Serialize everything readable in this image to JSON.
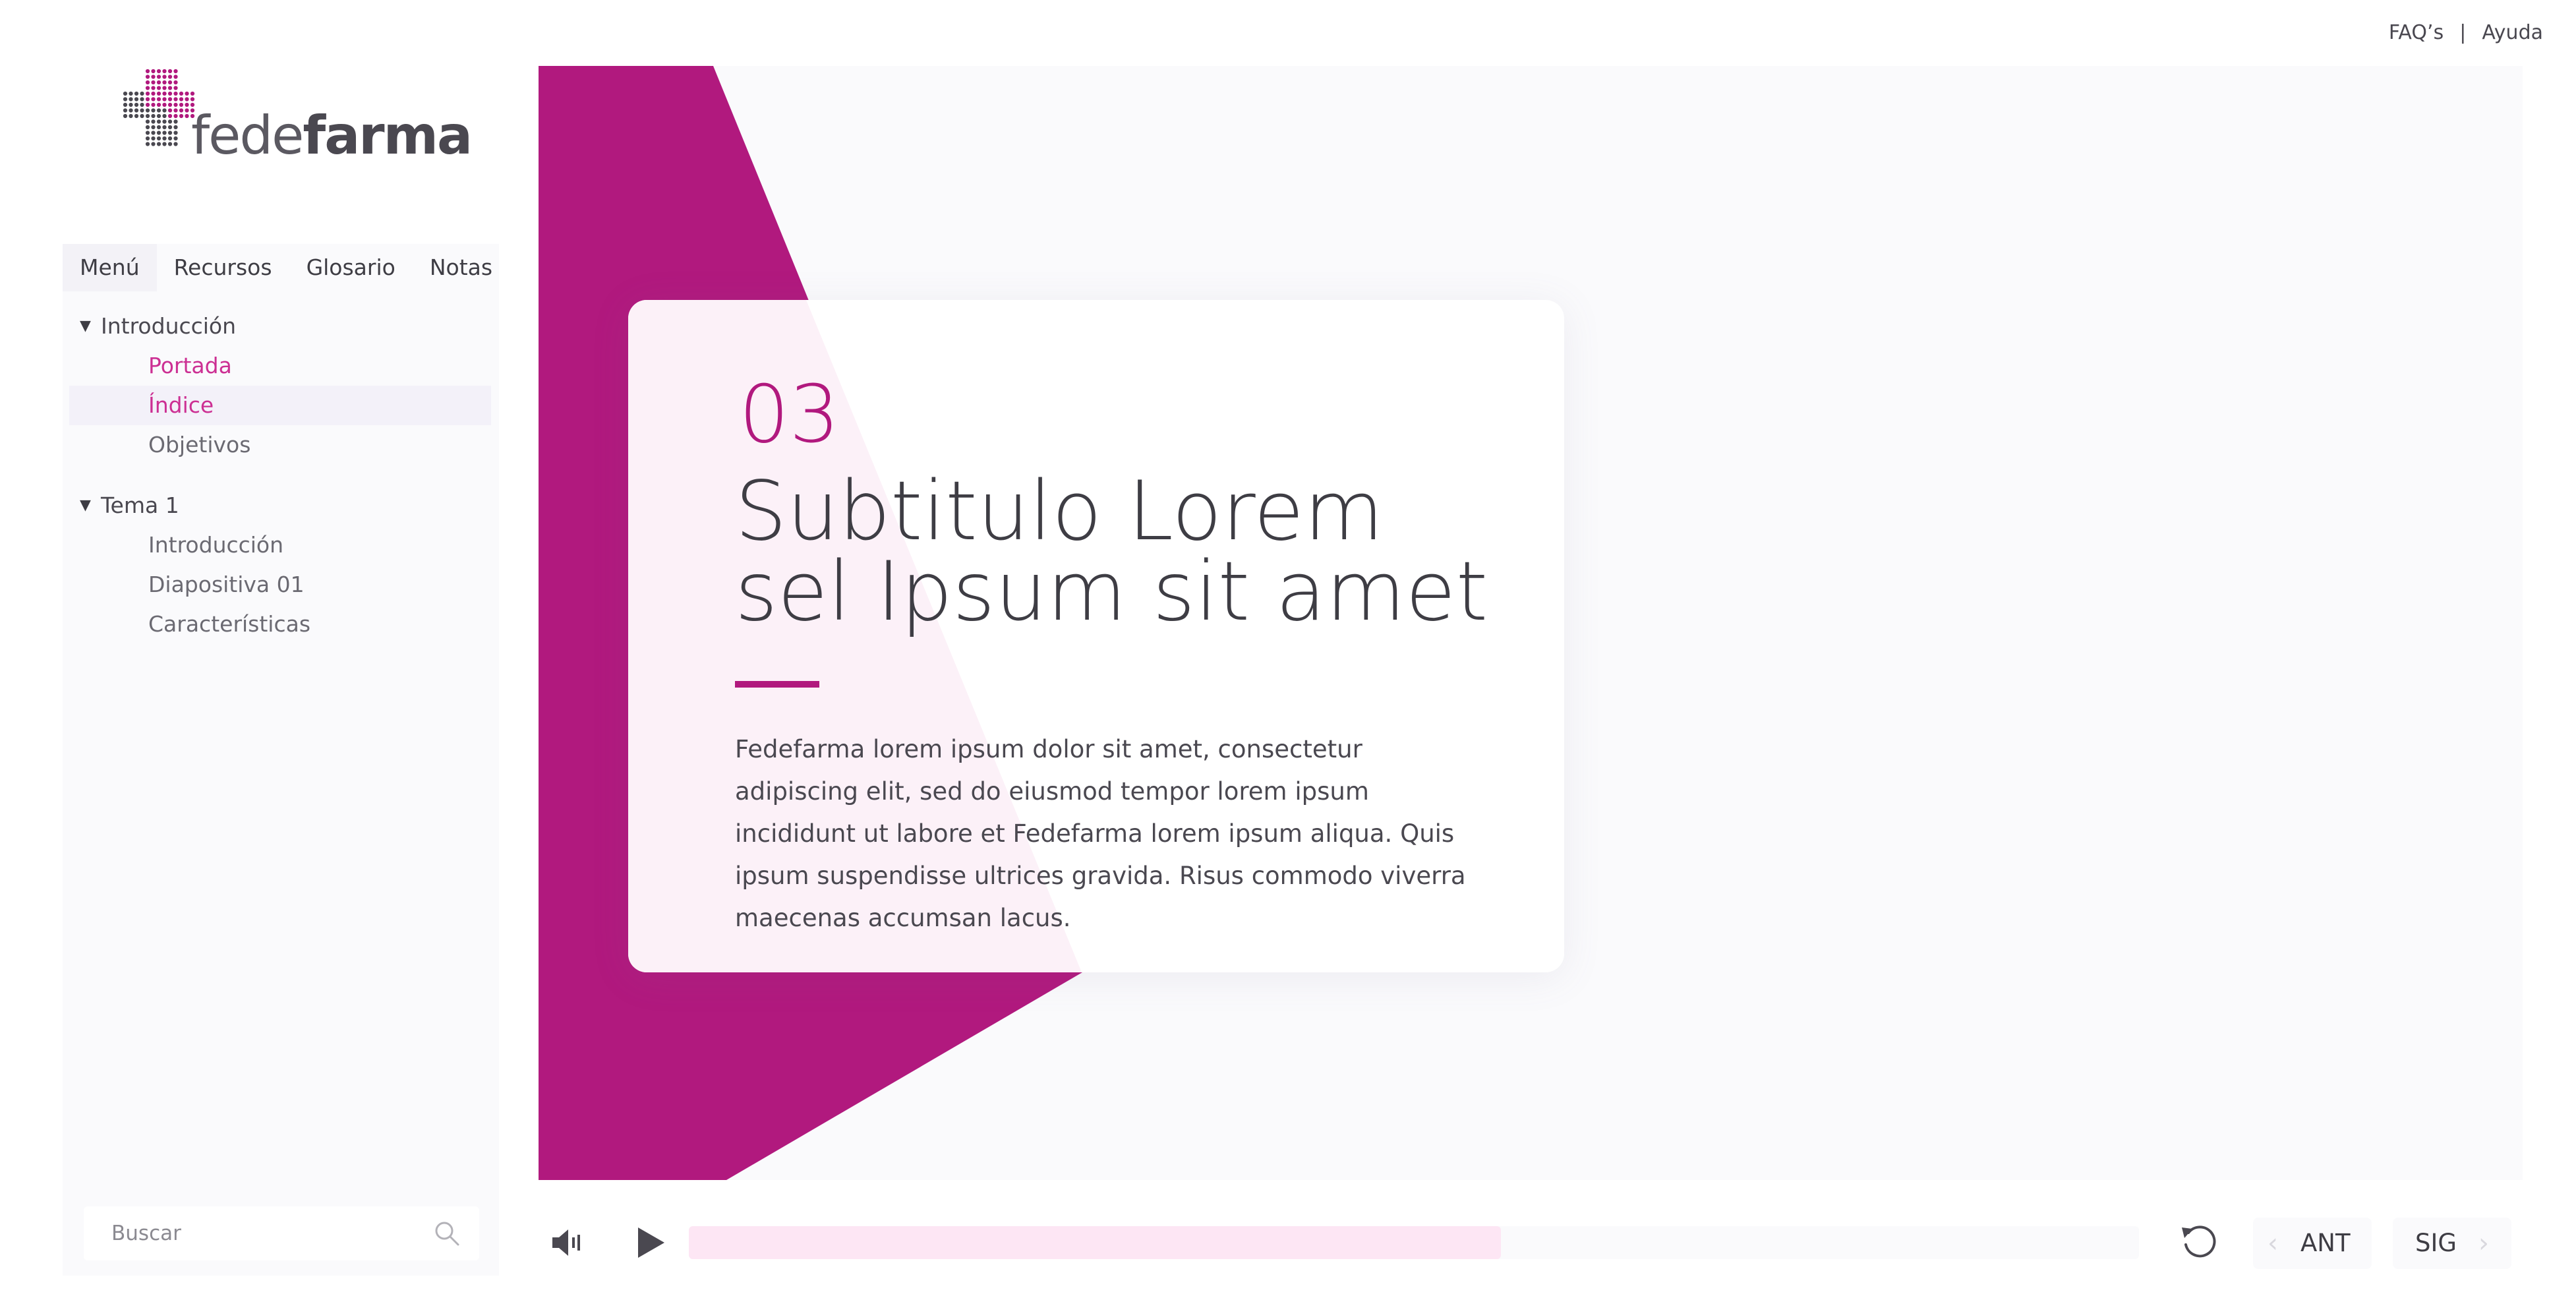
{
  "header": {
    "faq_label": "FAQ’s",
    "separator": "|",
    "help_label": "Ayuda"
  },
  "logo": {
    "text_light": "fede",
    "text_bold": "farma",
    "brand_color": "#b1197e"
  },
  "sidebar": {
    "tabs": [
      {
        "label": "Menú",
        "active": true
      },
      {
        "label": "Recursos",
        "active": false
      },
      {
        "label": "Glosario",
        "active": false
      },
      {
        "label": "Notas",
        "active": false
      }
    ],
    "groups": [
      {
        "label": "Introducción",
        "expanded": true,
        "items": [
          {
            "label": "Portada",
            "state": "visited"
          },
          {
            "label": "Índice",
            "state": "current"
          },
          {
            "label": "Objetivos",
            "state": "default"
          }
        ]
      },
      {
        "label": "Tema 1",
        "expanded": true,
        "items": [
          {
            "label": "Introducción",
            "state": "default"
          },
          {
            "label": "Diapositiva 01",
            "state": "default"
          },
          {
            "label": "Características",
            "state": "default"
          }
        ]
      }
    ],
    "search": {
      "placeholder": "Buscar",
      "value": ""
    }
  },
  "slide": {
    "number": "03",
    "title": "Subtitulo Lorem sel Ipsum sit amet",
    "body": "Fedefarma lorem ipsum dolor sit amet, consectetur adipiscing elit, sed do eiusmod tempor  lorem ipsum incididunt ut labore et Fedefarma lorem ipsum aliqua. Quis ipsum suspendisse ultrices gravida. Risus commodo viverra maecenas accumsan lacus.",
    "accent_color": "#b1197e"
  },
  "player": {
    "progress_fraction": 0.56,
    "prev_label": "ANT",
    "next_label": "SIG",
    "volume_icon": "volume-icon",
    "play_icon": "play-icon",
    "reload_icon": "reload-icon"
  }
}
